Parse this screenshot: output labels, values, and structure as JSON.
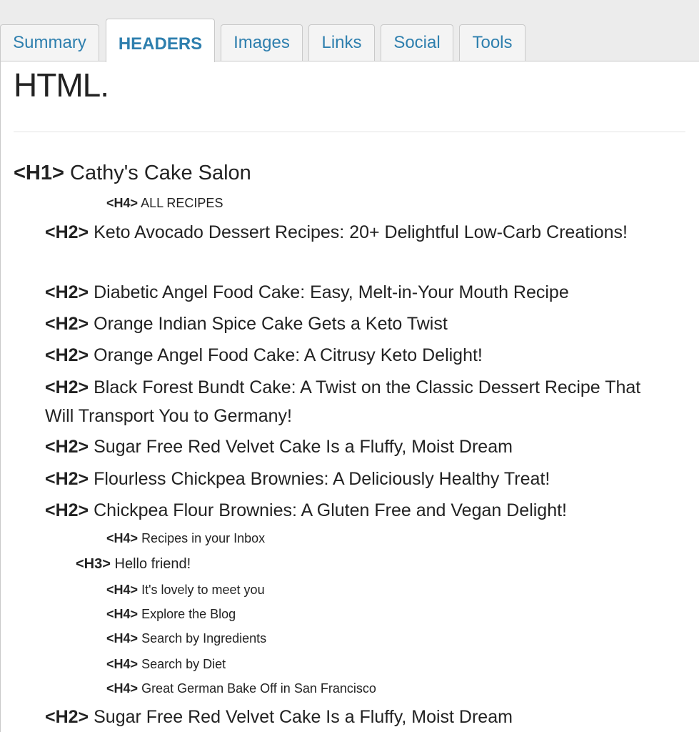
{
  "tabs": [
    {
      "label": "Summary"
    },
    {
      "label": "HEADERS"
    },
    {
      "label": "Images"
    },
    {
      "label": "Links"
    },
    {
      "label": "Social"
    },
    {
      "label": "Tools"
    }
  ],
  "panel": {
    "title": "HTML."
  },
  "headers": [
    {
      "tag": "<H1>",
      "text": "Cathy's Cake Salon"
    },
    {
      "tag": "<H4>",
      "text": "ALL RECIPES"
    },
    {
      "tag": "<H2>",
      "text": "Keto Avocado Dessert Recipes: 20+ Delightful Low-Carb Creations!"
    },
    {
      "tag": "<H2>",
      "text": "Diabetic Angel Food Cake: Easy, Melt-in-Your Mouth Recipe"
    },
    {
      "tag": "<H2>",
      "text": "Orange Indian Spice Cake Gets a Keto Twist"
    },
    {
      "tag": "<H2>",
      "text": "Orange Angel Food Cake: A Citrusy Keto Delight!"
    },
    {
      "tag": "<H2>",
      "text": "Black Forest Bundt Cake: A Twist on the Classic Dessert Recipe That Will Transport You to Germany!"
    },
    {
      "tag": "<H2>",
      "text": "Sugar Free Red Velvet Cake Is a Fluffy, Moist Dream"
    },
    {
      "tag": "<H2>",
      "text": "Flourless Chickpea Brownies: A Deliciously Healthy Treat!"
    },
    {
      "tag": "<H2>",
      "text": "Chickpea Flour Brownies: A Gluten Free and Vegan Delight!"
    },
    {
      "tag": "<H4>",
      "text": "Recipes in your Inbox"
    },
    {
      "tag": "<H3>",
      "text": "Hello friend!"
    },
    {
      "tag": "<H4>",
      "text": "It's lovely to meet you"
    },
    {
      "tag": "<H4>",
      "text": "Explore the Blog"
    },
    {
      "tag": "<H4>",
      "text": "Search by Ingredients"
    },
    {
      "tag": "<H4>",
      "text": "Search by Diet"
    },
    {
      "tag": "<H4>",
      "text": "Great German Bake Off in San Francisco"
    },
    {
      "tag": "<H2>",
      "text": "Sugar Free Red Velvet Cake Is a Fluffy, Moist Dream"
    }
  ],
  "colors": {
    "tab_text": "#2e7fae",
    "text": "#222222"
  }
}
